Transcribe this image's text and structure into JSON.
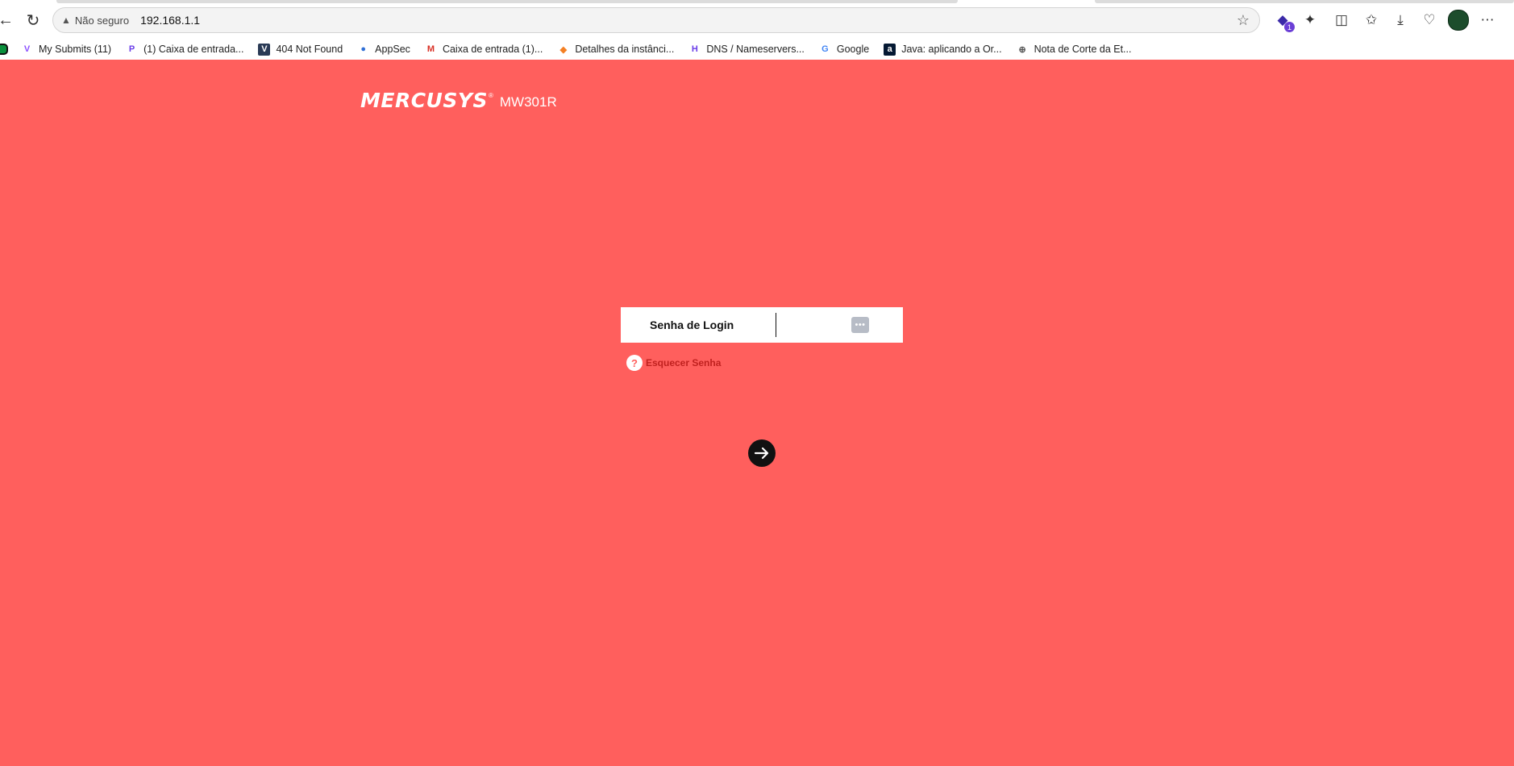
{
  "browser": {
    "security_label": "Não seguro",
    "url": "192.168.1.1",
    "profile_badge_count": "1"
  },
  "bookmarks": [
    {
      "label": "My Submits (11)",
      "icon": "v-icon",
      "color": "#8a4fff"
    },
    {
      "label": "(1) Caixa de entrada...",
      "icon": "p-icon",
      "color": "#6a3de8"
    },
    {
      "label": "404 Not Found",
      "icon": "v-shield-icon",
      "color": "#2a3a55"
    },
    {
      "label": "AppSec",
      "icon": "blue-circle-icon",
      "color": "#2f6fd6"
    },
    {
      "label": "Caixa de entrada (1)...",
      "icon": "gmail-icon",
      "color": "#d93025"
    },
    {
      "label": "Detalhes da instânci...",
      "icon": "aws-cube-icon",
      "color": "#f48024"
    },
    {
      "label": "DNS / Nameservers...",
      "icon": "h-icon",
      "color": "#6a3de8"
    },
    {
      "label": "Google",
      "icon": "google-icon",
      "color": "#4285f4"
    },
    {
      "label": "Java: aplicando a Or...",
      "icon": "alura-icon",
      "color": "#051933"
    },
    {
      "label": "Nota de Corte da Et...",
      "icon": "globe-icon",
      "color": "#555555"
    }
  ],
  "page": {
    "brand": "MERCUSYS",
    "registered": "®",
    "model": "MW301R",
    "login_label": "Senha de Login",
    "password_value": "",
    "forgot_label": "Esquecer Senha",
    "background": "#ff5f5d"
  }
}
